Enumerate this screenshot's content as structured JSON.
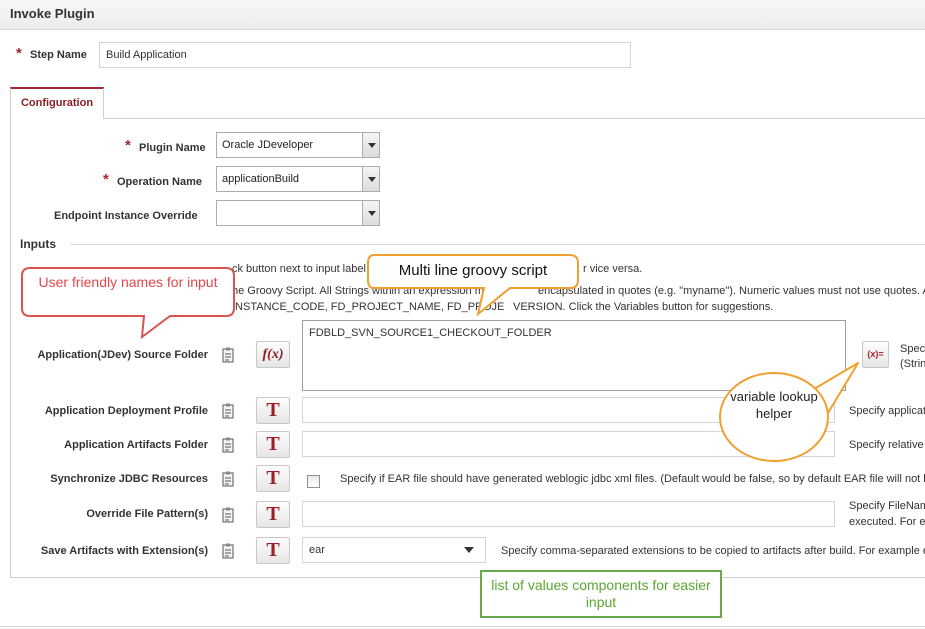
{
  "header": {
    "title": "Invoke Plugin"
  },
  "step": {
    "label": "Step Name",
    "value": "Build Application"
  },
  "tabs": [
    {
      "label": "Configuration"
    }
  ],
  "config": {
    "plugin_name": {
      "label": "Plugin Name",
      "value": "Oracle JDeveloper"
    },
    "operation_name": {
      "label": "Operation Name",
      "value": "applicationBuild"
    },
    "endpoint_override": {
      "label": "Endpoint Instance Override",
      "value": ""
    }
  },
  "inputs": {
    "title": "Inputs",
    "help_line1_a": "ck button next to input label t",
    "help_line1_b": "r vice versa.",
    "help_line2_a": "he Groovy Script. All Strings within an expression mu",
    "help_line2_b": "encapsulated in quotes (e.g. \"myname\"). Numeric values must not use quotes. All Vari",
    "help_line3_a": "INSTANCE_CODE, FD_PROJECT_NAME, FD_PROJE",
    "help_line3_b": "VERSION. Click the Variables button for suggestions.",
    "rows": [
      {
        "label": "Application(JDev) Source Folder",
        "value": "FDBLD_SVN_SOURCE1_CHECKOUT_FOLDER",
        "help1": "Speci",
        "help2": "(Strin"
      },
      {
        "label": "Application Deployment Profile",
        "value": "",
        "help1": "Specify applicat"
      },
      {
        "label": "Application Artifacts Folder",
        "value": "",
        "help1": "Specify relative"
      },
      {
        "label": "Synchronize JDBC Resources",
        "help1": "Specify if EAR file should have generated weblogic jdbc xml files. (Default would be false, so by default EAR file will not ha"
      },
      {
        "label": "Override File Pattern(s)",
        "value": "",
        "help1": "Specify FileNam",
        "help2": "executed. For e"
      },
      {
        "label": "Save Artifacts with Extension(s)",
        "value": "ear",
        "help1": "Specify comma-separated extensions to be copied to artifacts after build. For example e"
      }
    ],
    "buttons": {
      "fx": "f(x)",
      "T": "T",
      "var": "(x)="
    }
  },
  "callouts": {
    "user_friendly": "User friendly names for input",
    "groovy": "Multi line groovy script",
    "variable": "variable lookup helper",
    "lov": "list of values components for easier input"
  },
  "colors": {
    "accent": "#a5262d",
    "callout_red": "#d9534f",
    "callout_orange": "#f0a030",
    "callout_green": "#6aa84f"
  }
}
